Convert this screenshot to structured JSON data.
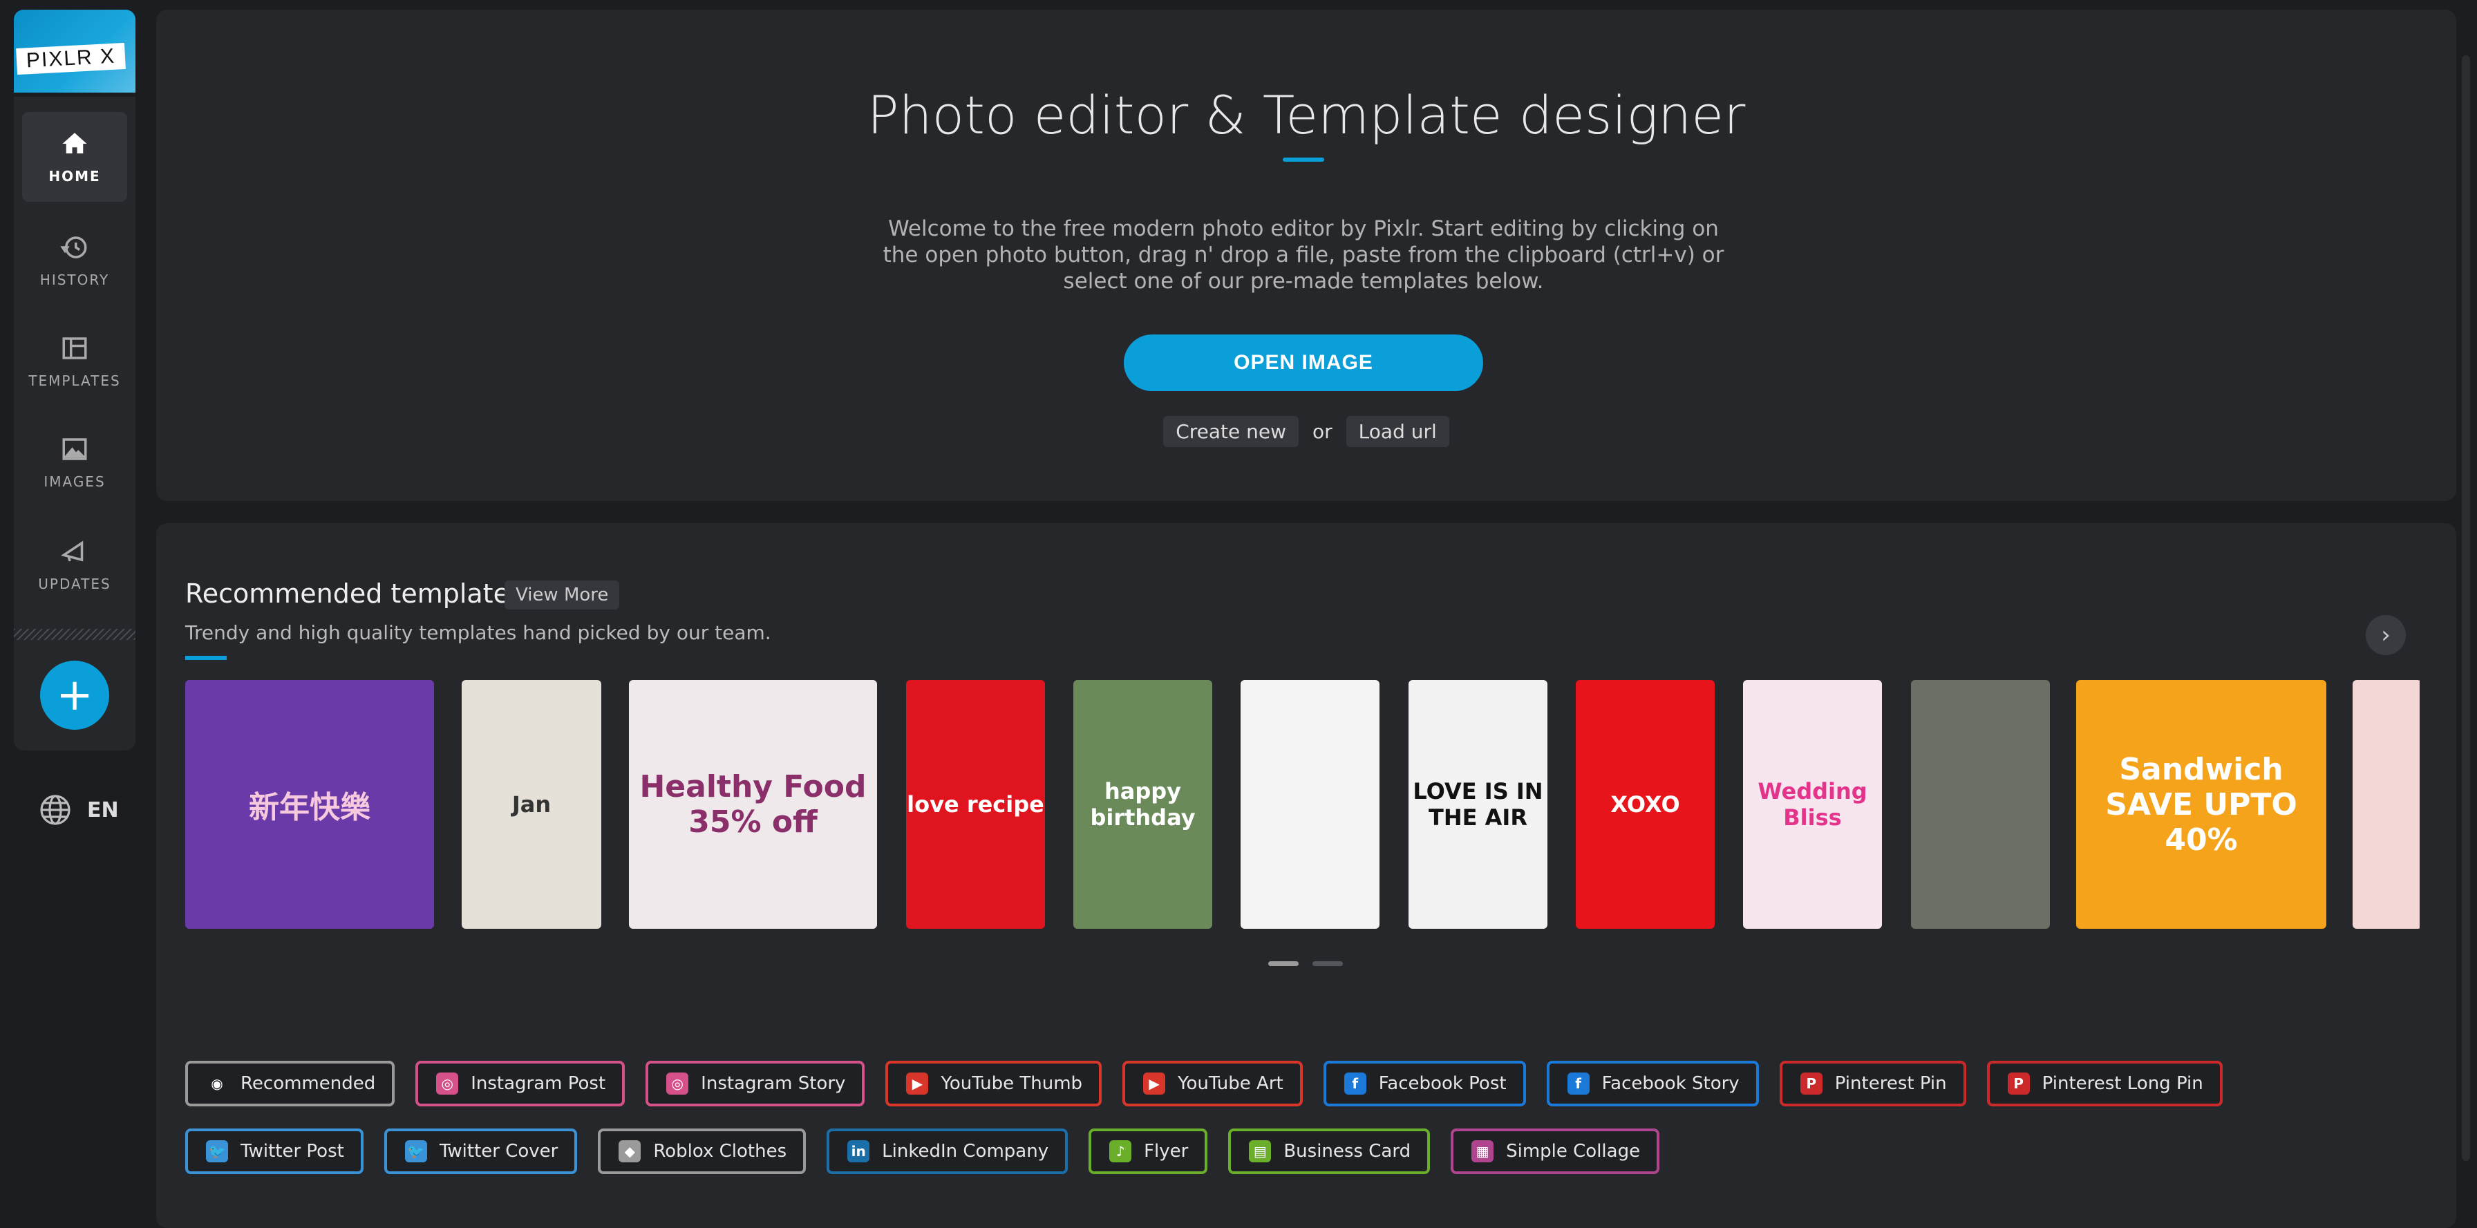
{
  "app": {
    "logo_text": "PIXLR X"
  },
  "sidebar": {
    "items": [
      {
        "label": "HOME",
        "icon": "home-icon",
        "active": true
      },
      {
        "label": "HISTORY",
        "icon": "history-icon"
      },
      {
        "label": "TEMPLATES",
        "icon": "templates-icon"
      },
      {
        "label": "IMAGES",
        "icon": "image-icon"
      },
      {
        "label": "UPDATES",
        "icon": "megaphone-icon"
      }
    ],
    "add_label": "+",
    "language": "EN"
  },
  "hero": {
    "title": "Photo editor & Template designer",
    "description": "Welcome to the free modern photo editor by Pixlr. Start editing by clicking on the open photo button, drag n' drop a file, paste from the clipboard (ctrl+v) or select one of our pre-made templates below.",
    "open_button": "OPEN IMAGE",
    "create_new": "Create new",
    "or": "or",
    "load_url": "Load url"
  },
  "recommended": {
    "title": "Recommended templates",
    "view_more": "View More",
    "subtitle": "Trendy and high quality templates hand picked by our team.",
    "templates": [
      {
        "text": "新年快樂",
        "bg": "#6a3aa8"
      },
      {
        "text": "Jan",
        "bg": "#e5e0d8"
      },
      {
        "text": "Healthy Food 35% off",
        "bg": "#efe9ec"
      },
      {
        "text": "love recipe",
        "bg": "#e0141e"
      },
      {
        "text": "happy birthday",
        "bg": "#6b8a5a"
      },
      {
        "text": "",
        "bg": "#f4f4f4"
      },
      {
        "text": "LOVE IS IN THE AIR",
        "bg": "#f2f2f2"
      },
      {
        "text": "XOXO",
        "bg": "#e8141c"
      },
      {
        "text": "Wedding Bliss",
        "bg": "#f7e6ef"
      },
      {
        "text": "",
        "bg": "#6b6f66"
      },
      {
        "text": "Sandwich SAVE UPTO 40%",
        "bg": "#f4a31a"
      },
      {
        "text": "",
        "bg": "#f3d6d6"
      }
    ],
    "pages": 2,
    "current_page": 1
  },
  "categories": [
    {
      "label": "Recommended",
      "color": "#9a9a9a",
      "icon": "eye-icon",
      "glyph": "◉"
    },
    {
      "label": "Instagram Post",
      "color": "#d6508a",
      "icon": "instagram-icon",
      "glyph": "◎"
    },
    {
      "label": "Instagram Story",
      "color": "#d6508a",
      "icon": "instagram-icon",
      "glyph": "◎"
    },
    {
      "label": "YouTube Thumb",
      "color": "#d9362b",
      "icon": "youtube-icon",
      "glyph": "▶"
    },
    {
      "label": "YouTube Art",
      "color": "#d9362b",
      "icon": "youtube-icon",
      "glyph": "▶"
    },
    {
      "label": "Facebook Post",
      "color": "#1b7ad9",
      "icon": "facebook-icon",
      "glyph": "f"
    },
    {
      "label": "Facebook Story",
      "color": "#1b7ad9",
      "icon": "facebook-icon",
      "glyph": "f"
    },
    {
      "label": "Pinterest Pin",
      "color": "#cc2a2a",
      "icon": "pinterest-icon",
      "glyph": "P"
    },
    {
      "label": "Pinterest Long Pin",
      "color": "#cc2a2a",
      "icon": "pinterest-icon",
      "glyph": "P"
    },
    {
      "label": "Twitter Post",
      "color": "#3a93d6",
      "icon": "twitter-icon",
      "glyph": "🐦"
    },
    {
      "label": "Twitter Cover",
      "color": "#3a93d6",
      "icon": "twitter-icon",
      "glyph": "🐦"
    },
    {
      "label": "Roblox Clothes",
      "color": "#9a9a9a",
      "icon": "roblox-icon",
      "glyph": "◆"
    },
    {
      "label": "LinkedIn Company",
      "color": "#1b6fa8",
      "icon": "linkedin-icon",
      "glyph": "in"
    },
    {
      "label": "Flyer",
      "color": "#6aae2a",
      "icon": "flyer-icon",
      "glyph": "♪"
    },
    {
      "label": "Business Card",
      "color": "#6aae2a",
      "icon": "business-card-icon",
      "glyph": "▤"
    },
    {
      "label": "Simple Collage",
      "color": "#b0458f",
      "icon": "collage-icon",
      "glyph": "▦"
    }
  ],
  "colors": {
    "accent": "#0a9fd8",
    "background": "#1c1d21",
    "panel": "#26272b"
  }
}
